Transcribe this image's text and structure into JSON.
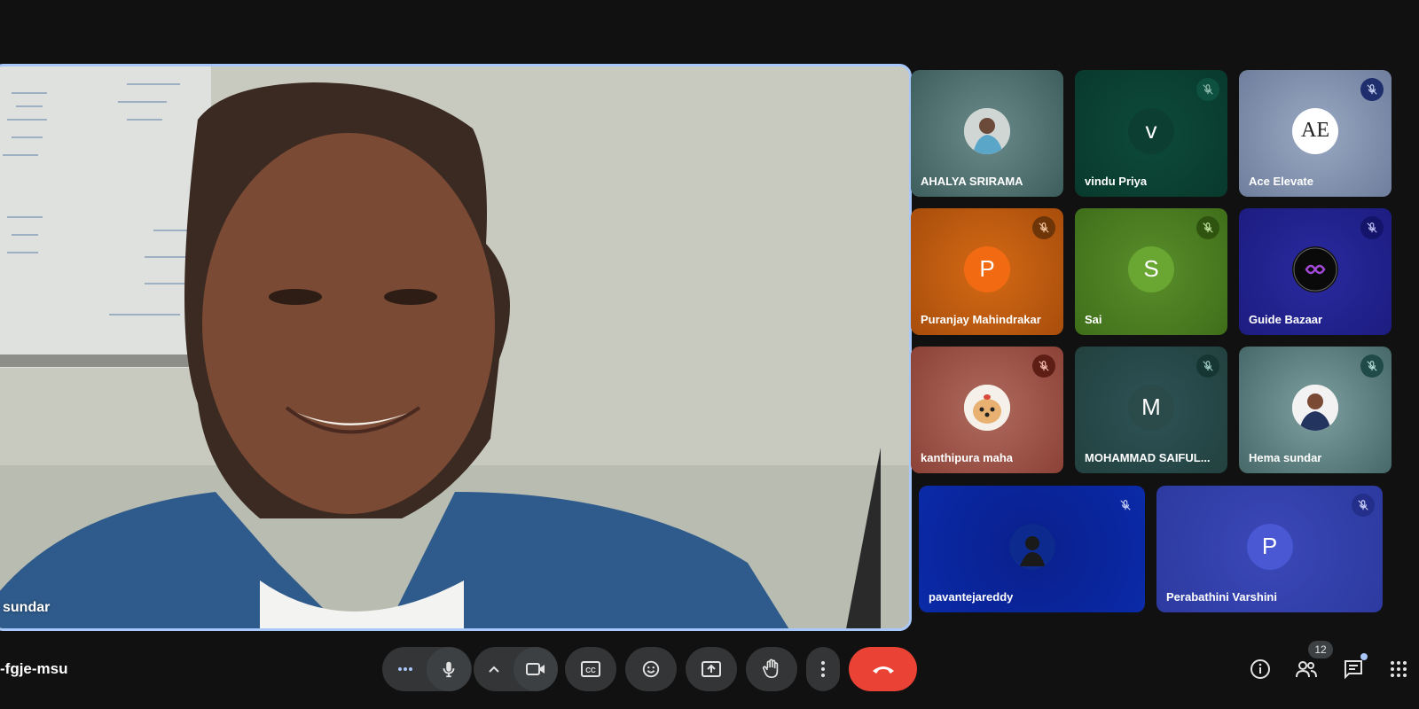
{
  "main_speaker": {
    "name": "sundar"
  },
  "participants": [
    {
      "name": "AHALYA SRIRAMA",
      "avatar_type": "photo",
      "muted": false
    },
    {
      "name": "vindu Priya",
      "avatar_letter": "v",
      "muted": true
    },
    {
      "name": "Ace Elevate",
      "avatar_letter": "AE",
      "muted": true
    },
    {
      "name": "Puranjay Mahindrakar",
      "avatar_letter": "P",
      "muted": true
    },
    {
      "name": "Sai",
      "avatar_letter": "S",
      "muted": true
    },
    {
      "name": "Guide Bazaar",
      "avatar_type": "logo",
      "muted": true
    },
    {
      "name": "kanthipura maha",
      "avatar_type": "photo",
      "muted": true
    },
    {
      "name": "MOHAMMAD SAIFUL...",
      "avatar_letter": "M",
      "muted": true
    },
    {
      "name": "Hema sundar",
      "avatar_type": "photo",
      "muted": true
    },
    {
      "name": "pavantejareddy",
      "avatar_type": "photo",
      "muted": true
    },
    {
      "name": "Perabathini Varshini",
      "avatar_letter": "P",
      "muted": true
    }
  ],
  "meeting": {
    "code": "-fgje-msu"
  },
  "controls": {
    "more_options": "more-options",
    "microphone": "mic-icon",
    "camera": "camera-icon",
    "captions": "captions-icon",
    "reactions": "emoji-icon",
    "present": "present-icon",
    "raise_hand": "hand-icon",
    "overflow": "vertical-dots-icon",
    "leave": "end-call-icon"
  },
  "right_panel": {
    "people_count": "12"
  },
  "colors": {
    "leave": "#ea4335",
    "accent": "#a8c7fa",
    "control_bg": "#333537"
  }
}
